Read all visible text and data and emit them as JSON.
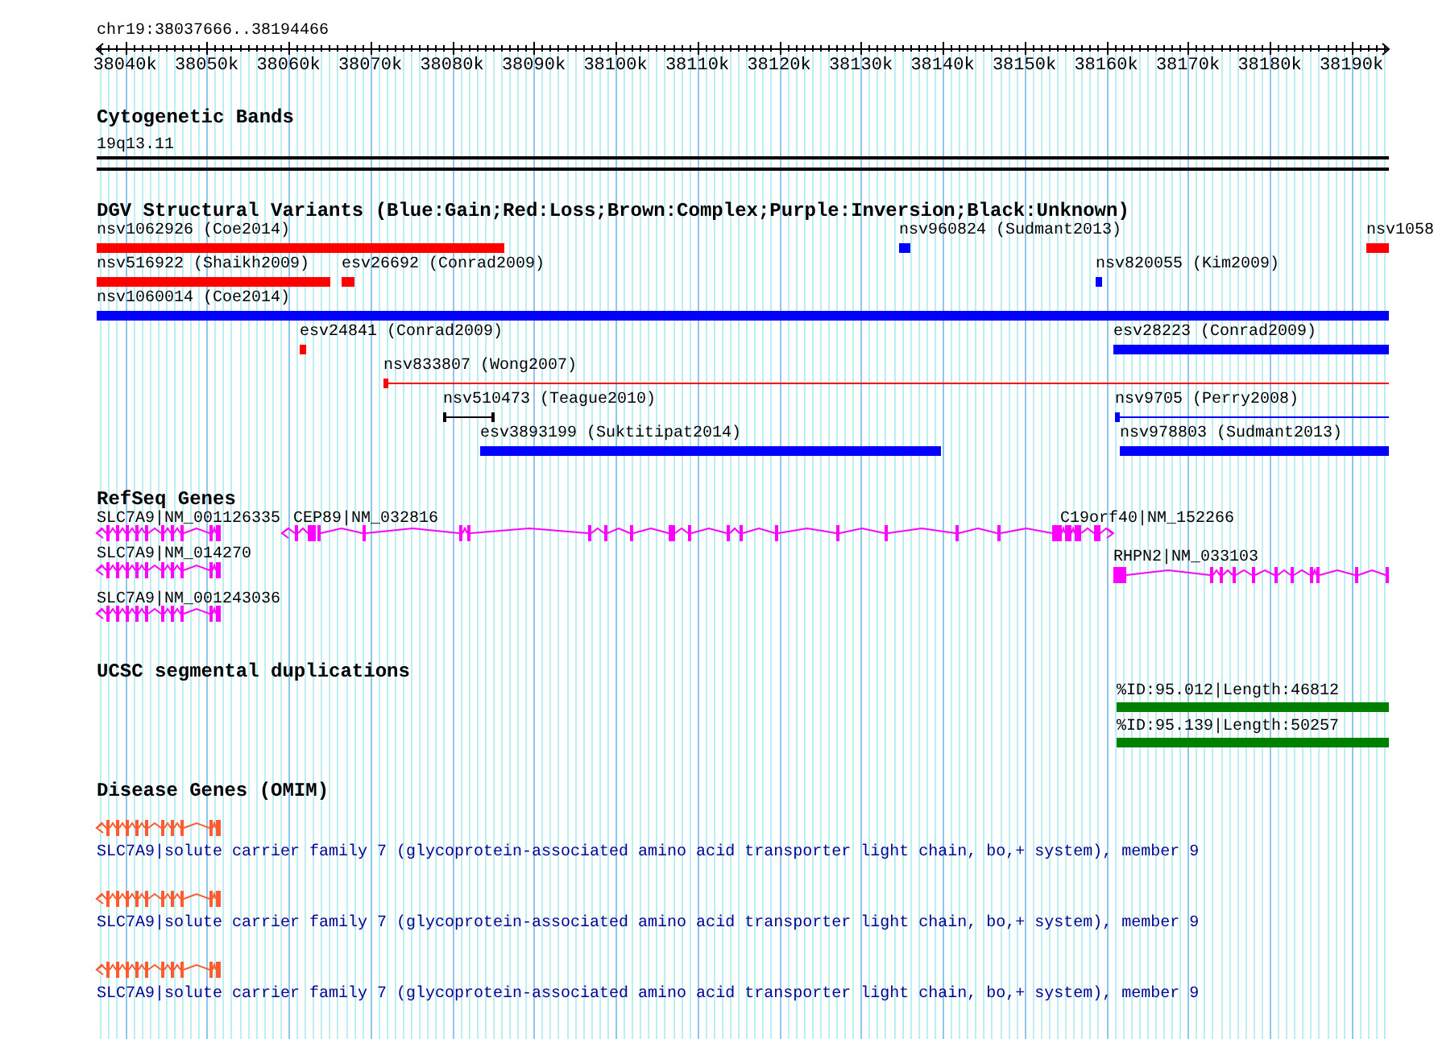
{
  "locus": {
    "label": "chr19:38037666..38194466",
    "ticks": [
      "38040k",
      "38050k",
      "38060k",
      "38070k",
      "38080k",
      "38090k",
      "38100k",
      "38110k",
      "38120k",
      "38130k",
      "38140k",
      "38150k",
      "38160k",
      "38170k",
      "38180k",
      "38190k"
    ]
  },
  "cytobands": {
    "title": "Cytogenetic Bands",
    "band": "19q13.11"
  },
  "dgv": {
    "title": "DGV Structural Variants (Blue:Gain;Red:Loss;Brown:Complex;Purple:Inversion;Black:Unknown)",
    "rows": [
      {
        "features": [
          {
            "label": "nsv1062926 (Coe2014)",
            "kind": "bar",
            "color": "#ff0000"
          },
          {
            "label": "nsv960824 (Sudmant2013)",
            "kind": "bar",
            "color": "#0000ff"
          },
          {
            "label": "nsv1058",
            "kind": "bar",
            "color": "#ff0000"
          }
        ]
      },
      {
        "features": [
          {
            "label": "nsv516922 (Shaikh2009)",
            "kind": "bar",
            "color": "#ff0000"
          },
          {
            "label": "esv26692 (Conrad2009)",
            "kind": "bar",
            "color": "#ff0000"
          },
          {
            "label": "nsv820055 (Kim2009)",
            "kind": "bar",
            "color": "#0000ff"
          }
        ]
      },
      {
        "features": [
          {
            "label": "nsv1060014 (Coe2014)",
            "kind": "bar",
            "color": "#0000ff"
          }
        ]
      },
      {
        "features": [
          {
            "label": "esv24841 (Conrad2009)",
            "kind": "bar",
            "color": "#ff0000"
          },
          {
            "label": "esv28223 (Conrad2009)",
            "kind": "bar",
            "color": "#0000ff"
          }
        ]
      },
      {
        "features": [
          {
            "label": "nsv833807 (Wong2007)",
            "kind": "line",
            "color": "#ff0000"
          }
        ]
      },
      {
        "features": [
          {
            "label": "nsv510473 (Teague2010)",
            "kind": "bracket",
            "color": "#000000"
          },
          {
            "label": "nsv9705 (Perry2008)",
            "kind": "line",
            "color": "#0000ff"
          }
        ]
      },
      {
        "features": [
          {
            "label": "esv3893199 (Suktitipat2014)",
            "kind": "bar",
            "color": "#0000ff"
          },
          {
            "label": "nsv978803 (Sudmant2013)",
            "kind": "bar",
            "color": "#0000ff"
          }
        ]
      }
    ]
  },
  "refseq": {
    "title": "RefSeq Genes",
    "genes": [
      {
        "label": "SLC7A9|NM_001126335"
      },
      {
        "label": "CEP89|NM_032816"
      },
      {
        "label": "C19orf40|NM_152266"
      },
      {
        "label": "SLC7A9|NM_014270"
      },
      {
        "label": "RHPN2|NM_033103"
      },
      {
        "label": "SLC7A9|NM_001243036"
      }
    ]
  },
  "segdups": {
    "title": "UCSC segmental duplications",
    "features": [
      {
        "label": "%ID:95.012|Length:46812"
      },
      {
        "label": "%ID:95.139|Length:50257"
      }
    ]
  },
  "omim": {
    "title": "Disease Genes (OMIM)",
    "genes": [
      {
        "label": "SLC7A9|solute carrier family 7 (glycoprotein-associated amino acid transporter light chain, bo,+ system), member 9"
      },
      {
        "label": "SLC7A9|solute carrier family 7 (glycoprotein-associated amino acid transporter light chain, bo,+ system), member 9"
      },
      {
        "label": "SLC7A9|solute carrier family 7 (glycoprotein-associated amino acid transporter light chain, bo,+ system), member 9"
      }
    ]
  }
}
